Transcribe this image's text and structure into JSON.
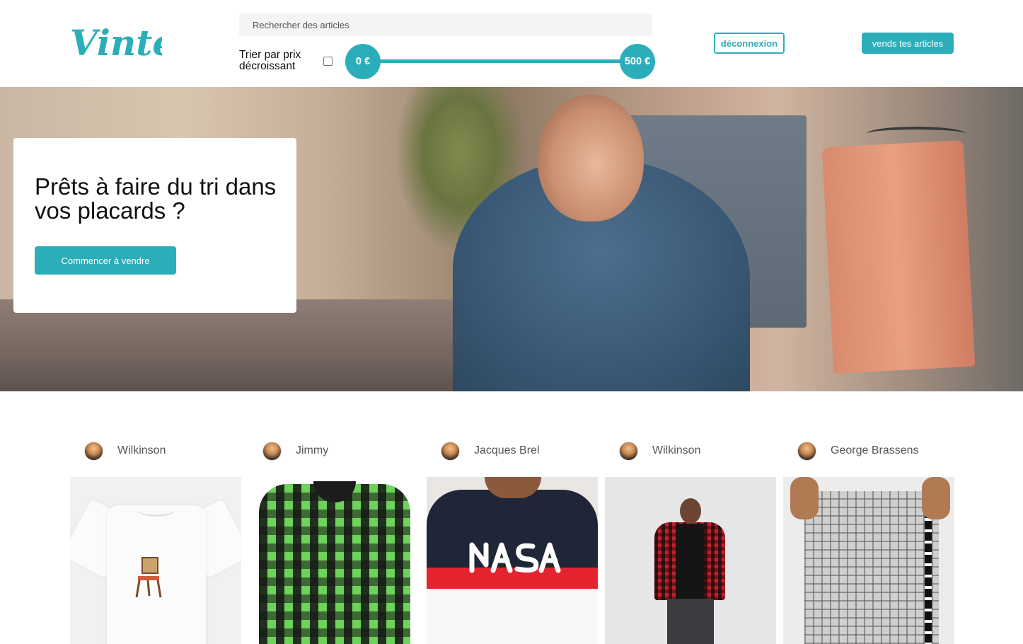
{
  "header": {
    "logo_text": "Vinted",
    "search_placeholder": "Rechercher des articles",
    "sort_label": "Trier par prix décroissant",
    "sort_checked": false,
    "price_min_label": "0 €",
    "price_max_label": "500 €",
    "logout_label": "déconnexion",
    "sell_label": "vends tes articles"
  },
  "hero": {
    "title": "Prêts à faire du tri dans vos placards ?",
    "cta_label": "Commencer à vendre"
  },
  "products": [
    {
      "seller": "Wilkinson",
      "image": "white t-shirt with chair print"
    },
    {
      "seller": "Jimmy",
      "image": "green and black flannel shirt"
    },
    {
      "seller": "Jacques Brel",
      "image": "NASA t-shirt"
    },
    {
      "seller": "Wilkinson",
      "image": "man in red plaid shirt"
    },
    {
      "seller": "George Brassens",
      "image": "grey plaid trousers"
    }
  ],
  "colors": {
    "accent": "#2caeba",
    "header_bg": "#ffffff",
    "search_bg": "#f3f4f5"
  }
}
